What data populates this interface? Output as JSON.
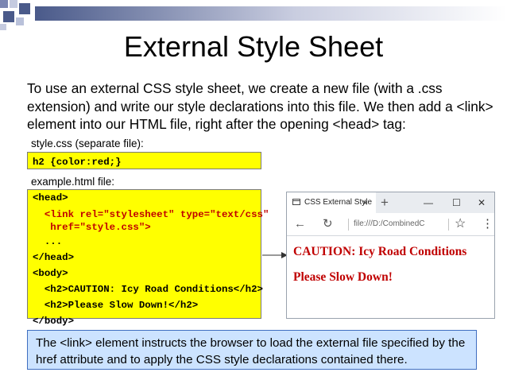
{
  "slide": {
    "title": "External Style Sheet",
    "intro": "To use an external CSS style sheet, we create a new file (with a .css extension) and write our style declarations into this file. We then add a <link> element into our HTML file, right after the opening <head> tag:",
    "css_label": "style.css (separate file):",
    "css_code": "h2 {color:red;}",
    "html_label": "example.html file:",
    "html_code": [
      "<head>",
      "  <link rel=\"stylesheet\" type=\"text/css\"",
      "   href=\"style.css\">",
      "  ...",
      "</head>",
      "<body>",
      "  <h2>CAUTION: Icy Road Conditions</h2>",
      "  <h2>Please Slow Down!</h2>",
      "</body>"
    ],
    "note": "The <link> element instructs the browser to load the external file specified by the href attribute and to apply the CSS style declarations contained there."
  },
  "browser": {
    "tab_title": "CSS External Style",
    "tab_close": "×",
    "new_tab": "+",
    "minimize": "—",
    "maximize": "☐",
    "close": "✕",
    "back": "←",
    "refresh": "↻",
    "url": "file:///D:/CombinedC",
    "star": "☆",
    "more": "⋮",
    "headings": [
      "CAUTION: Icy Road Conditions",
      "Please Slow Down!"
    ]
  },
  "colors": {
    "code_bg": "#ffff00",
    "heading_red": "#c00000",
    "note_bg": "#cce3ff",
    "note_border": "#3f6ec0",
    "bar_dark": "#4a5a8a"
  }
}
